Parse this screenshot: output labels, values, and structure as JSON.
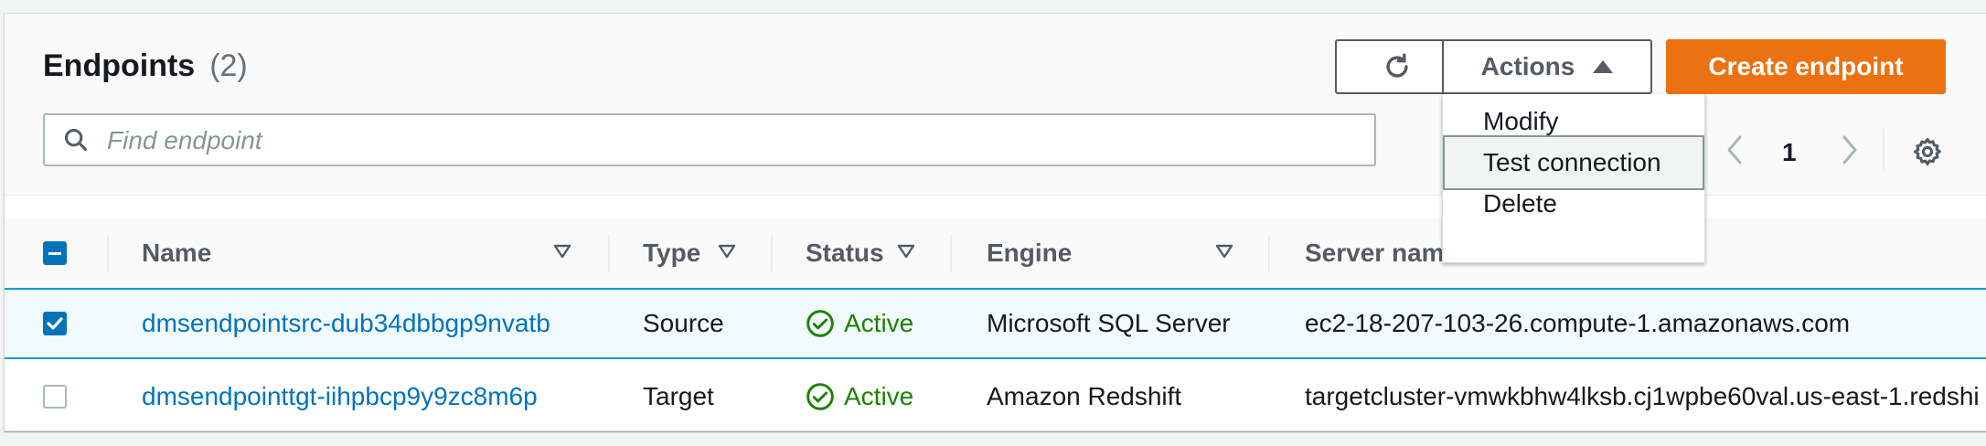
{
  "header": {
    "title": "Endpoints",
    "count": "(2)",
    "actions_label": "Actions",
    "create_label": "Create endpoint"
  },
  "search": {
    "placeholder": "Find endpoint",
    "value": ""
  },
  "actions_menu": {
    "items": [
      {
        "label": "Modify"
      },
      {
        "label": "Test connection"
      },
      {
        "label": "Delete"
      }
    ],
    "hovered": "Test connection"
  },
  "pagination": {
    "current_page": "1"
  },
  "table": {
    "columns": [
      "Name",
      "Type",
      "Status",
      "Engine",
      "Server nam"
    ],
    "rows": [
      {
        "selected": true,
        "name": "dmsendpointsrc-dub34dbbgp9nvatb",
        "type": "Source",
        "status": "Active",
        "engine": "Microsoft SQL Server",
        "server": "ec2-18-207-103-26.compute-1.amazonaws.com"
      },
      {
        "selected": false,
        "name": "dmsendpointtgt-iihpbcp9y9zc8m6p",
        "type": "Target",
        "status": "Active",
        "engine": "Amazon Redshift",
        "server": "targetcluster-vmwkbhw4lksb.cj1wpbe60val.us-east-1.redshi"
      }
    ]
  },
  "colors": {
    "primary_button": "#ec7211",
    "link": "#0073bb",
    "status_active": "#1d8102",
    "selected_row_border": "#00a1c9"
  },
  "icons": [
    "refresh-icon",
    "caret-up-icon",
    "search-icon",
    "chevron-left-icon",
    "chevron-right-icon",
    "gear-icon",
    "sort-icon",
    "check-circle-icon",
    "checkmark-icon"
  ]
}
